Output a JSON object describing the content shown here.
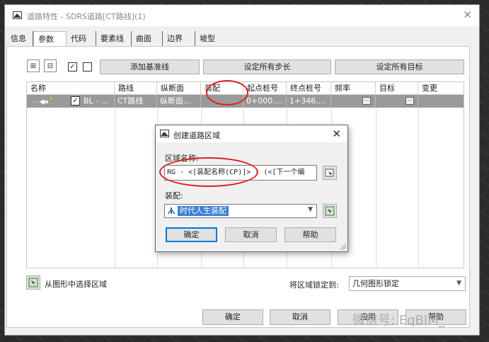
{
  "window": {
    "title": "道路特性 - SDRS道路[CT路线](1)"
  },
  "tabs": [
    {
      "label": "信息"
    },
    {
      "label": "参数"
    },
    {
      "label": "代码"
    },
    {
      "label": "要素线"
    },
    {
      "label": "曲面"
    },
    {
      "label": "边界"
    },
    {
      "label": "坡型"
    }
  ],
  "toolbar": {
    "add_baseline": "添加基准线",
    "set_all_steps": "设定所有步长",
    "set_all_targets": "设定所有目标"
  },
  "grid": {
    "columns": [
      "名称",
      "路线",
      "纵断面",
      "装配",
      "起点桩号",
      "终点桩号",
      "频率",
      "目标",
      "变更"
    ],
    "row": {
      "name": "BL - ...",
      "alignment": "CT路线",
      "profile": "纵断面...",
      "assembly": "",
      "start": "0+000....",
      "end": "1+346...."
    }
  },
  "bottom": {
    "select_region": "从图形中选择区域",
    "lock_label": "将区域锁定到:",
    "lock_value": "几何图形锁定"
  },
  "footer": {
    "ok": "确定",
    "cancel": "取消",
    "apply": "应用",
    "help": "帮助"
  },
  "watermark": "微信号: EqBIM_",
  "dialog": {
    "title": "创建道路区域",
    "region_name_label": "区域名称:",
    "region_name_value": "RG - <[装配名称(CP)]> - (<[下一个编",
    "assembly_label": "装配:",
    "assembly_value": "时代人生装配",
    "ok": "确定",
    "cancel": "取消",
    "help": "帮助"
  },
  "colors": {
    "highlight": "#3b7fd6",
    "annotation": "#e02020",
    "row_selected": "#9a9a9a"
  }
}
